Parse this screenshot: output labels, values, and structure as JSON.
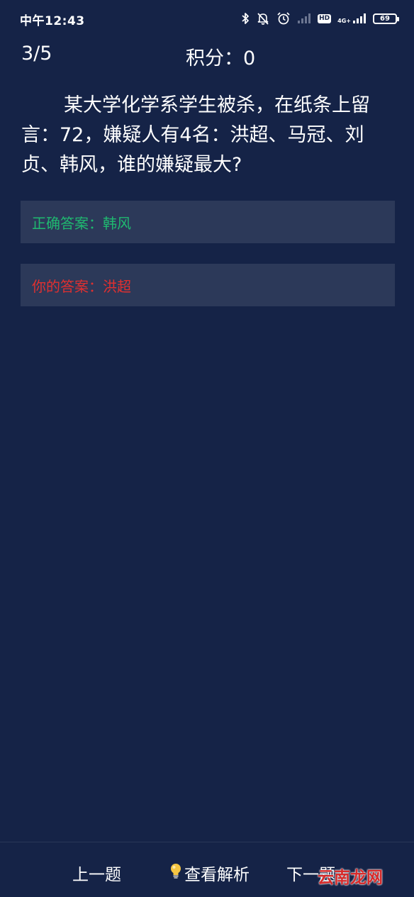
{
  "status_bar": {
    "time": "中午12:43",
    "network": "4G+",
    "hd": "HD",
    "battery": "69",
    "icons": [
      "bluetooth-icon",
      "silent-icon",
      "alarm-icon",
      "signal-weak-icon",
      "hd-icon",
      "signal-4g-icon",
      "battery-icon"
    ]
  },
  "header": {
    "progress": "3/5",
    "score": "积分：0"
  },
  "question": {
    "text": "某大学化学系学生被杀，在纸条上留言：72，嫌疑人有4名：洪超、马冠、刘贞、韩风，谁的嫌疑最大?"
  },
  "answers": {
    "correct": "正确答案：韩风",
    "yours": "你的答案：洪超"
  },
  "bottom_nav": {
    "prev_label": "上一题",
    "analysis_label": "查看解析",
    "next_label": "下一题"
  },
  "watermark": "云南龙网",
  "colors": {
    "background": "#152347",
    "answer_box": "#2c3959",
    "correct": "#1fb970",
    "wrong": "#e03030"
  }
}
